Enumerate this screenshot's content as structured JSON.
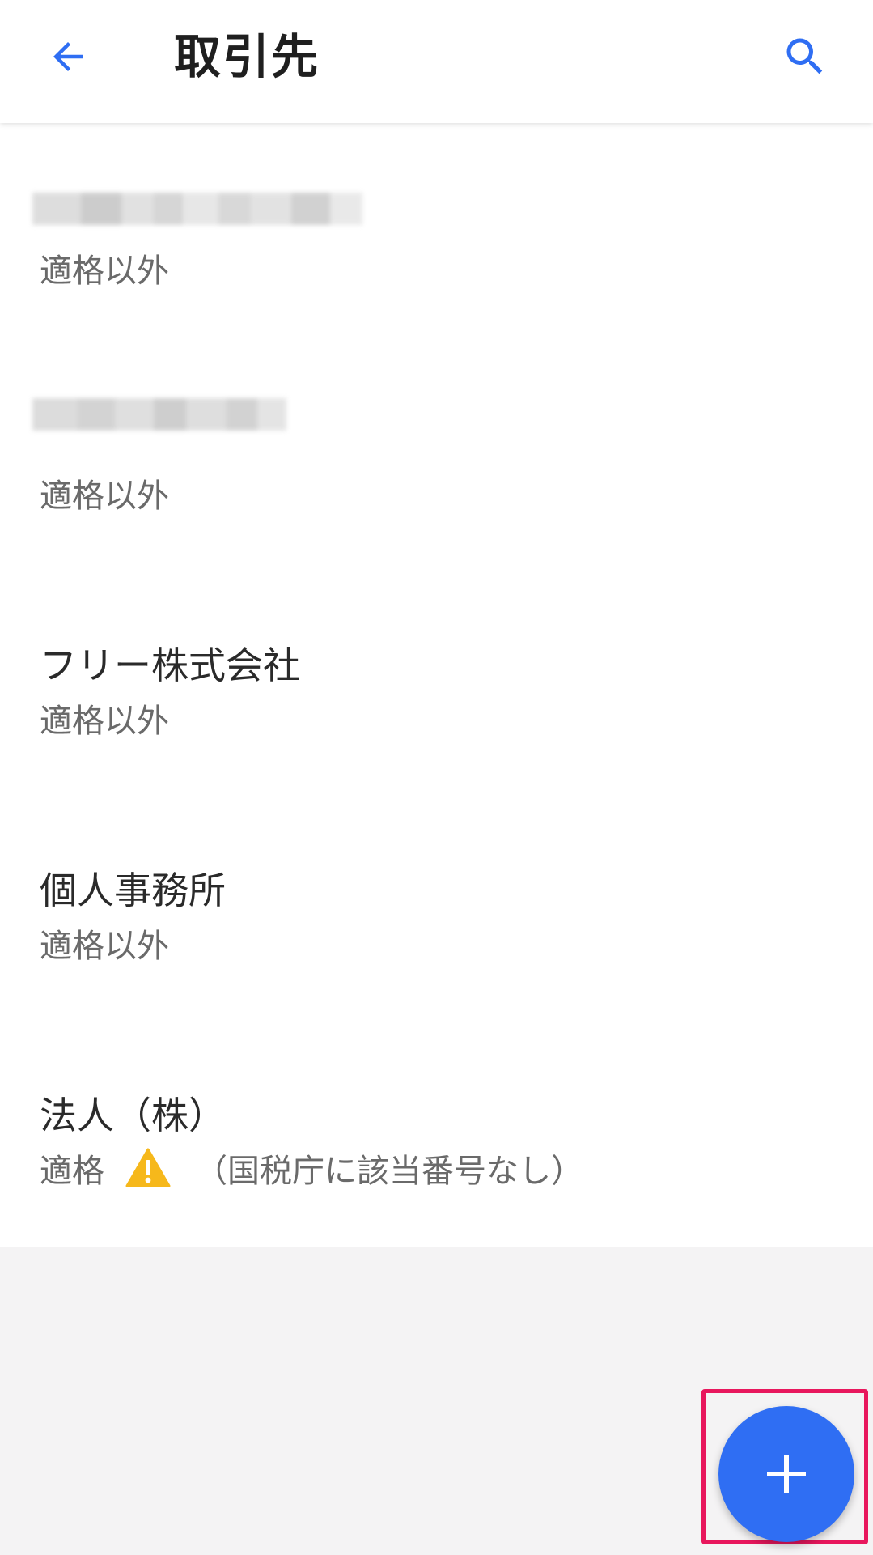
{
  "appbar": {
    "title": "取引先",
    "back_icon": "arrow-back-icon",
    "search_icon": "search-icon"
  },
  "colors": {
    "accent": "#2f6ef3",
    "warning": "#f6b81b",
    "highlight": "#e8175d"
  },
  "partners": [
    {
      "name": "",
      "status": "適格以外"
    },
    {
      "name": "",
      "status": "適格以外"
    },
    {
      "name": "フリー株式会社",
      "status": "適格以外"
    },
    {
      "name": "個人事務所",
      "status": "適格以外"
    },
    {
      "name": "法人（株）",
      "status": "適格",
      "warning_note": "（国税庁に該当番号なし）"
    }
  ],
  "fab": {
    "icon": "plus-icon"
  }
}
